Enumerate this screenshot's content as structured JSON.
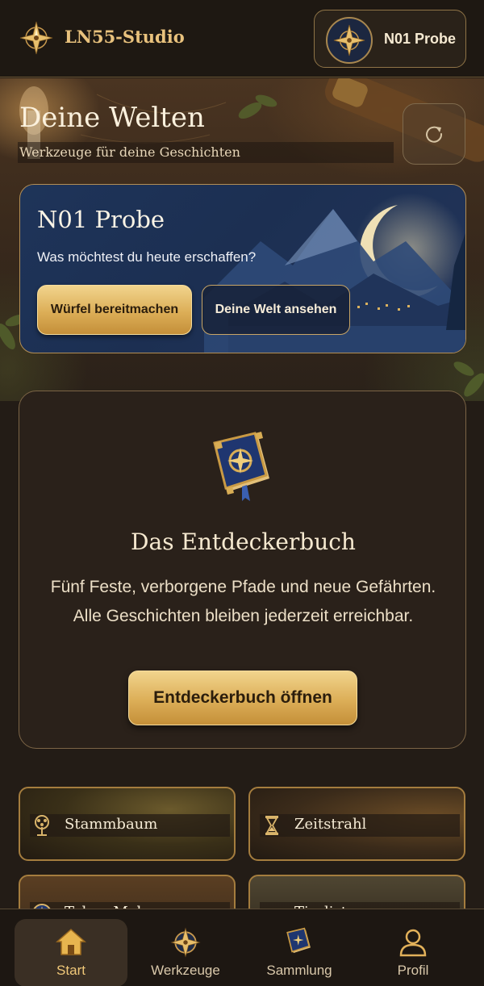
{
  "header": {
    "brand_name": "LN55-Studio",
    "brand_icon": "compass-star-icon",
    "current_world": "N01 Probe"
  },
  "hero": {
    "title": "Deine Welten",
    "subtitle": "Werkzeuge für deine Geschichten",
    "refresh_icon": "refresh-icon"
  },
  "world_card": {
    "title": "N01 Probe",
    "prompt": "Was möchtest du heute erschaffen?",
    "primary_button": "Würfel bereitmachen",
    "secondary_button": "Deine Welt ansehen"
  },
  "discovery": {
    "title": "Das Entdeckerbuch",
    "text": "Fünf Feste, verborgene Pfade und neue Gefährten. Alle Geschichten bleiben jederzeit erreichbar.",
    "button": "Entdeckerbuch öffnen",
    "icon": "book-icon"
  },
  "tools": [
    {
      "label": "Stammbaum",
      "icon": "tree-icon"
    },
    {
      "label": "Zeitstrahl",
      "icon": "hourglass-icon"
    },
    {
      "label": "Token Maker",
      "icon": "compass-icon"
    },
    {
      "label": "Tierlisten",
      "icon": "key-icon"
    }
  ],
  "bottom_nav": [
    {
      "label": "Start",
      "icon": "home-icon",
      "active": true
    },
    {
      "label": "Werkzeuge",
      "icon": "compass-star-icon",
      "active": false
    },
    {
      "label": "Sammlung",
      "icon": "book-icon",
      "active": false
    },
    {
      "label": "Profil",
      "icon": "person-icon",
      "active": false
    }
  ],
  "colors": {
    "background": "#231c16",
    "accent_gold": "#dcae57",
    "world_card_blue": "#1e3459"
  }
}
